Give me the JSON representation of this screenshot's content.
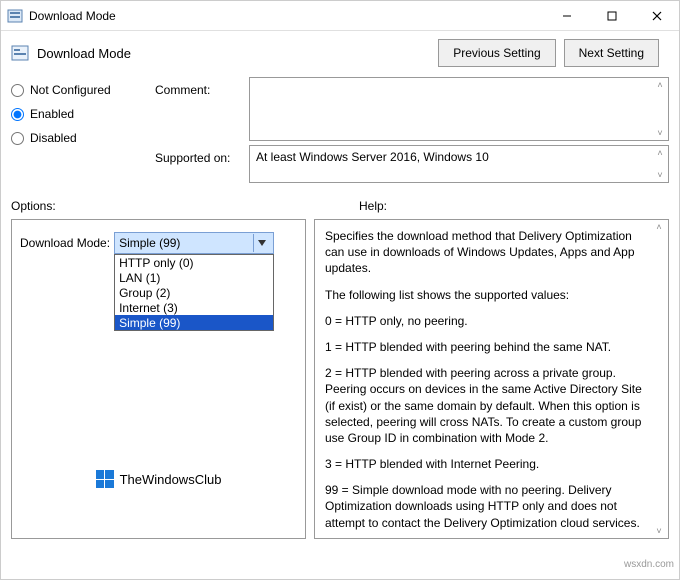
{
  "window": {
    "title": "Download Mode"
  },
  "header": {
    "title": "Download Mode",
    "prev_btn": "Previous Setting",
    "next_btn": "Next Setting"
  },
  "state": {
    "radios": {
      "not_configured": "Not Configured",
      "enabled": "Enabled",
      "disabled": "Disabled",
      "selected": "enabled"
    },
    "comment_label": "Comment:",
    "comment_value": "",
    "supported_label": "Supported on:",
    "supported_value": "At least Windows Server 2016, Windows 10"
  },
  "labels": {
    "options": "Options:",
    "help": "Help:"
  },
  "options": {
    "field_label": "Download Mode:",
    "selected": "Simple (99)",
    "items": [
      "HTTP only (0)",
      "LAN (1)",
      "Group (2)",
      "Internet (3)",
      "Simple (99)"
    ]
  },
  "help": {
    "p1": "Specifies the download method that Delivery Optimization can use in downloads of Windows Updates, Apps and App updates.",
    "p2": "The following list shows the supported values:",
    "p3": "0 = HTTP only, no peering.",
    "p4": "1 = HTTP blended with peering behind the same NAT.",
    "p5": "2 = HTTP blended with peering across a private group. Peering occurs on devices in the same Active Directory Site (if exist) or the same domain by default. When this option is selected, peering will cross NATs. To create a custom group use Group ID in combination with Mode 2.",
    "p6": "3 = HTTP blended with Internet Peering.",
    "p7": "99 = Simple download mode with no peering. Delivery Optimization downloads using HTTP only and does not attempt to contact the Delivery Optimization cloud services."
  },
  "brand": {
    "text": "TheWindowsClub"
  },
  "watermark": "wsxdn.com"
}
